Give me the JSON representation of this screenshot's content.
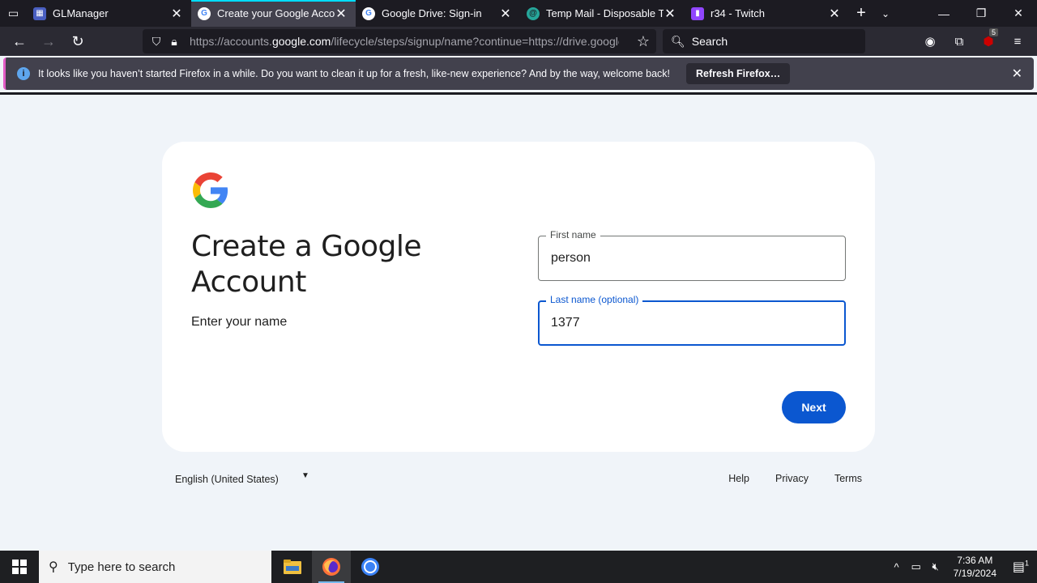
{
  "tabs": [
    {
      "title": "GLManager",
      "active": false,
      "favicon": "glmanager-icon"
    },
    {
      "title": "Create your Google Account",
      "active": true,
      "favicon": "google-icon"
    },
    {
      "title": "Google Drive: Sign-in",
      "active": false,
      "favicon": "google-icon"
    },
    {
      "title": "Temp Mail - Disposable Temporary Email",
      "active": false,
      "favicon": "tempmail-icon"
    },
    {
      "title": "r34 - Twitch",
      "active": false,
      "favicon": "twitch-icon"
    }
  ],
  "navbar": {
    "url_prefix": "https://accounts.",
    "url_domain": "google.com",
    "url_suffix": "/lifecycle/steps/signup/name?continue=https://drive.google.com",
    "search_placeholder": "Search",
    "ublock_count": "5"
  },
  "notification": {
    "message": "It looks like you haven’t started Firefox in a while. Do you want to clean it up for a fresh, like-new experience? And by the way, welcome back!",
    "button_label": "Refresh Firefox…"
  },
  "page": {
    "heading": "Create a Google Account",
    "subtitle": "Enter your name",
    "first_name_label": "First name",
    "first_name_value": "person",
    "last_name_label": "Last name (optional)",
    "last_name_value": "1377",
    "next_label": "Next"
  },
  "footer": {
    "language": "English (United States)",
    "links": [
      "Help",
      "Privacy",
      "Terms"
    ]
  },
  "taskbar": {
    "search_placeholder": "Type here to search",
    "time": "7:36 AM",
    "date": "7/19/2024",
    "notification_count": "1"
  },
  "colors": {
    "accent_blue": "#0b57d0",
    "page_bg": "#f0f4f9",
    "browser_dark": "#1c1b22",
    "tab_active_indicator": "#00ddff"
  }
}
